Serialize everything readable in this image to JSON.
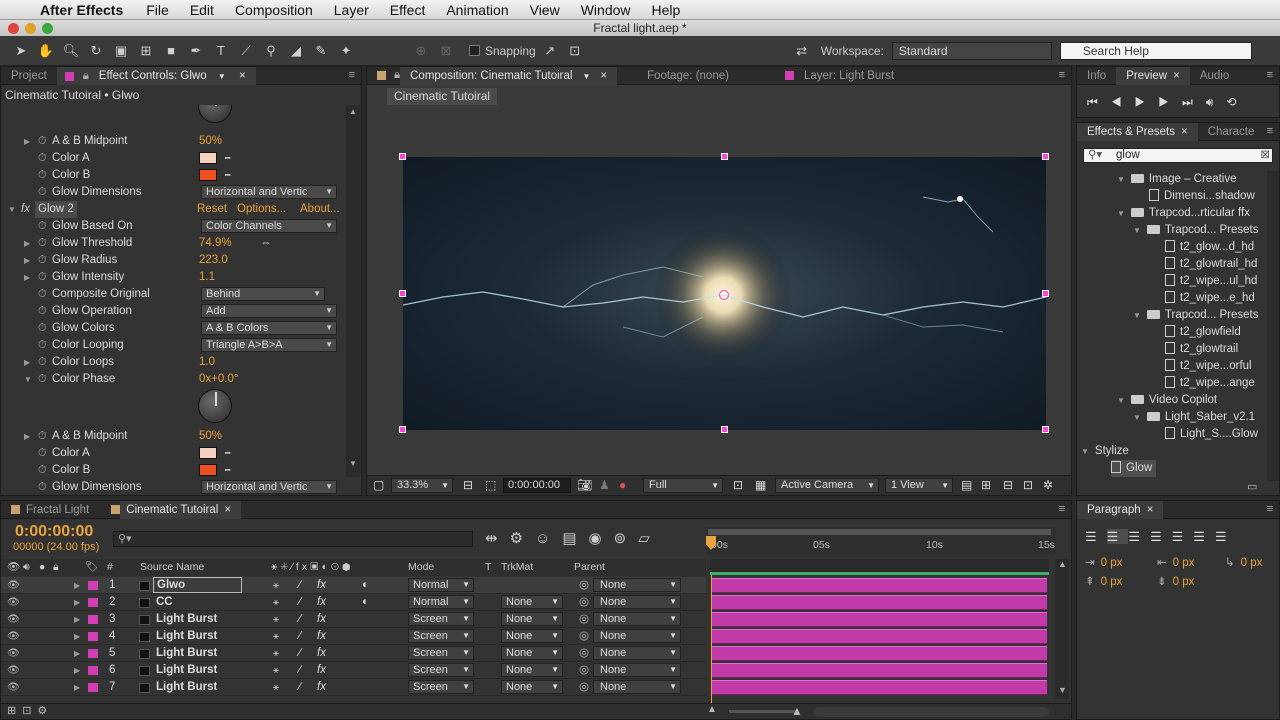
{
  "menubar": {
    "app": "After Effects",
    "items": [
      "File",
      "Edit",
      "Composition",
      "Layer",
      "Effect",
      "Animation",
      "View",
      "Window",
      "Help"
    ]
  },
  "window": {
    "title": "Fractal light.aep *"
  },
  "toolbar": {
    "snapping": "Snapping",
    "workspace_label": "Workspace:",
    "workspace_value": "Standard",
    "search_placeholder": "Search Help"
  },
  "left_panel": {
    "tabs": [
      "Project",
      "Effect Controls: Glwo"
    ],
    "breadcrumb": "Cinematic Tutoiral • Glwo",
    "rows": [
      {
        "name": "A & B Midpoint",
        "value": "50%"
      },
      {
        "name": "Color A",
        "color": "#f7d0c0"
      },
      {
        "name": "Color B",
        "color": "#f05020"
      },
      {
        "name": "Glow Dimensions",
        "dropdown": "Horizontal and Vertic"
      },
      {
        "effect": "Glow 2",
        "links": [
          "Reset",
          "Options...",
          "About..."
        ]
      },
      {
        "name": "Glow Based On",
        "dropdown": "Color Channels"
      },
      {
        "name": "Glow Threshold",
        "value": "74.9%"
      },
      {
        "name": "Glow Radius",
        "value": "223.0"
      },
      {
        "name": "Glow Intensity",
        "value": "1.1"
      },
      {
        "name": "Composite Original",
        "dropdown": "Behind"
      },
      {
        "name": "Glow Operation",
        "dropdown": "Add"
      },
      {
        "name": "Glow Colors",
        "dropdown": "A & B Colors"
      },
      {
        "name": "Color Looping",
        "dropdown": "Triangle A>B>A"
      },
      {
        "name": "Color Loops",
        "value": "1.0"
      },
      {
        "name": "Color Phase",
        "value": "0x+0.0°"
      },
      {
        "name": "A & B Midpoint",
        "value": "50%"
      },
      {
        "name": "Color A",
        "color": "#f7d0c0"
      },
      {
        "name": "Color B",
        "color": "#f05020"
      },
      {
        "name": "Glow Dimensions",
        "dropdown": "Horizontal and Vertic"
      }
    ]
  },
  "comp_panel": {
    "tabs": [
      "Composition: Cinematic Tutoiral",
      "Footage: (none)",
      "Layer: Light Burst"
    ],
    "comp_tab": "Cinematic Tutoiral",
    "zoom": "33.3%",
    "timecode": "0:00:00:00",
    "resolution": "Full",
    "camera": "Active Camera",
    "view": "1 View"
  },
  "right_panel": {
    "tabs": [
      "Info",
      "Preview",
      "Audio"
    ],
    "effects_tabs": [
      "Effects & Presets",
      "Characte"
    ],
    "search_value": "glow",
    "tree": [
      {
        "type": "folder",
        "label": "Image – Creative"
      },
      {
        "type": "file",
        "label": "Dimensi...shadow"
      },
      {
        "type": "folder",
        "label": "Trapcod...rticular ffx"
      },
      {
        "type": "folder",
        "label": "Trapcod... Presets"
      },
      {
        "type": "file",
        "label": "t2_glow...d_hd"
      },
      {
        "type": "file",
        "label": "t2_glowtrail_hd"
      },
      {
        "type": "file",
        "label": "t2_wipe...ul_hd"
      },
      {
        "type": "file",
        "label": "t2_wipe...e_hd"
      },
      {
        "type": "folder",
        "label": "Trapcod... Presets"
      },
      {
        "type": "file",
        "label": "t2_glowfield"
      },
      {
        "type": "file",
        "label": "t2_glowtrail"
      },
      {
        "type": "file",
        "label": "t2_wipe...orful"
      },
      {
        "type": "file",
        "label": "t2_wipe...ange"
      },
      {
        "type": "folder",
        "label": "Video Copilot"
      },
      {
        "type": "folder",
        "label": "Light_Saber_v2.1"
      },
      {
        "type": "file",
        "label": "Light_S....Glow"
      },
      {
        "type": "folder",
        "label": "Stylize"
      },
      {
        "type": "file",
        "label": "Glow"
      }
    ],
    "paragraph": {
      "tab": "Paragraph",
      "values": [
        "0 px",
        "0 px",
        "0 px",
        "0 px",
        "0 px"
      ]
    }
  },
  "timeline": {
    "tabs": [
      "Fractal Light",
      "Cinematic Tutoiral"
    ],
    "timecode": "0:00:00:00",
    "frames": "00000 (24.00 fps)",
    "columns": {
      "source": "Source Name",
      "mode": "Mode",
      "t": "T",
      "trkmat": "TrkMat",
      "parent": "Parent"
    },
    "ruler": [
      "00s",
      "05s",
      "10s",
      "15s"
    ],
    "layers": [
      {
        "num": "1",
        "name": "Glwo",
        "mode": "Normal",
        "trkmat": "",
        "parent": "None"
      },
      {
        "num": "2",
        "name": "CC",
        "mode": "Normal",
        "trkmat": "None",
        "parent": "None"
      },
      {
        "num": "3",
        "name": "Light Burst",
        "mode": "Screen",
        "trkmat": "None",
        "parent": "None"
      },
      {
        "num": "4",
        "name": "Light Burst",
        "mode": "Screen",
        "trkmat": "None",
        "parent": "None"
      },
      {
        "num": "5",
        "name": "Light Burst",
        "mode": "Screen",
        "trkmat": "None",
        "parent": "None"
      },
      {
        "num": "6",
        "name": "Light Burst",
        "mode": "Screen",
        "trkmat": "None",
        "parent": "None"
      },
      {
        "num": "7",
        "name": "Light Burst",
        "mode": "Screen",
        "trkmat": "None",
        "parent": "None"
      }
    ]
  }
}
